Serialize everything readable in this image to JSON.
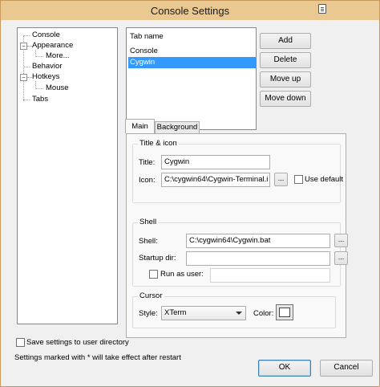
{
  "window": {
    "title": "Console Settings"
  },
  "tree": {
    "items": [
      {
        "label": "Console"
      },
      {
        "label": "Appearance",
        "expander": "−"
      },
      {
        "label": "More..."
      },
      {
        "label": "Behavior"
      },
      {
        "label": "Hotkeys",
        "expander": "−"
      },
      {
        "label": "Mouse"
      },
      {
        "label": "Tabs"
      }
    ]
  },
  "tab_list": {
    "header": "Tab name",
    "rows": [
      "Console",
      "Cygwin"
    ],
    "selected": "Cygwin"
  },
  "tab_buttons": {
    "add": "Add",
    "delete": "Delete",
    "move_up": "Move up",
    "move_down": "Move down"
  },
  "panel_tabs": {
    "main": "Main",
    "background": "Background"
  },
  "title_icon": {
    "group": "Title & icon",
    "title_label": "Title:",
    "title_value": "Cygwin",
    "icon_label": "Icon:",
    "icon_value": "C:\\cygwin64\\Cygwin-Terminal.i",
    "browse": "...",
    "use_default": "Use default"
  },
  "shell": {
    "group": "Shell",
    "shell_label": "Shell:",
    "shell_value": "C:\\cygwin64\\Cygwin.bat",
    "startup_label": "Startup dir:",
    "startup_value": "",
    "run_as_user": "Run as user:",
    "run_as_value": "",
    "browse": "..."
  },
  "cursor": {
    "group": "Cursor",
    "style_label": "Style:",
    "style_value": "XTerm",
    "color_label": "Color:",
    "color_value": "#ffffff"
  },
  "footer": {
    "save_to_user": "Save settings to user directory",
    "restart_note": "Settings marked with * will take effect after restart",
    "ok": "OK",
    "cancel": "Cancel"
  }
}
